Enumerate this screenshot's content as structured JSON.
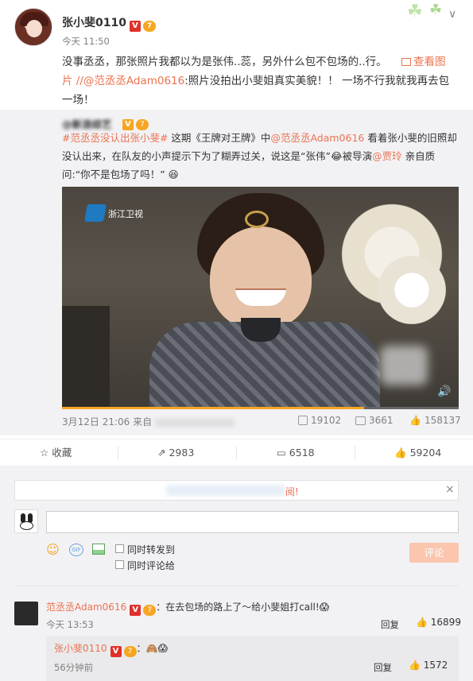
{
  "post": {
    "username": "张小斐0110",
    "verified_badge": "V",
    "level_badge": "7",
    "timestamp": "今天 11:50",
    "text_main": "没事丞丞，那张照片我都以为是张伟..蕊，另外什么包不包场的..行。",
    "view_image_1": "查看图",
    "view_image_2": "片",
    "mention": "//@范丞丞Adam0616",
    "text_after_mention": ":照片没拍出小斐姐真实美貌！！ 一场不行我就我再去包一场！",
    "close_label": "∨",
    "clover_decoration": "☘"
  },
  "repost": {
    "author_mention": "@新浪综艺",
    "hashtag": "#范丞丞没认出张小斐#",
    "text_1": " 这期《王牌对王牌》中",
    "mention_1": "@范丞丞Adam0616",
    "text_2": " 看着张小斐的旧照却没认出来，在队友的小声提示下为了糊弄过关，说这是“张伟”",
    "emoji_1": "😂",
    "text_3": "被导演",
    "mention_2": "@贾玲",
    "text_4": " 亲自质问:“你不是包场了吗！”",
    "emoji_2": "😆",
    "video_channel": "浙江卫视",
    "volume_icon": "🔊",
    "date": "3月12日 21:06 来自",
    "share_count": "19102",
    "comment_count": "3661",
    "like_count": "158137"
  },
  "actions": {
    "favorite": "收藏",
    "share": "2983",
    "comment": "6518",
    "like": "59204"
  },
  "comment_box": {
    "notice": "阅!",
    "notice_close": "×",
    "also_repost": "同时转发到",
    "also_comment": "同时评论给",
    "submit": "评论"
  },
  "comments": [
    {
      "username": "范丞丞Adam0616",
      "level_badge": "7",
      "text": "：在去包场的路上了～给小斐姐打call!",
      "emoji": "😱",
      "time": "今天 13:53",
      "reply": "回复",
      "likes": "16899"
    }
  ],
  "reply": {
    "username": "张小斐0110",
    "level_badge": "7",
    "text": "：",
    "emoji": "🙈😱",
    "time": "56分钟前",
    "reply": "回复",
    "likes": "1572"
  },
  "colors": {
    "link": "#eb7350",
    "background_gray": "#f2f2f5",
    "verified_red": "#e0302a",
    "button_disabled": "#fbc6ae"
  }
}
